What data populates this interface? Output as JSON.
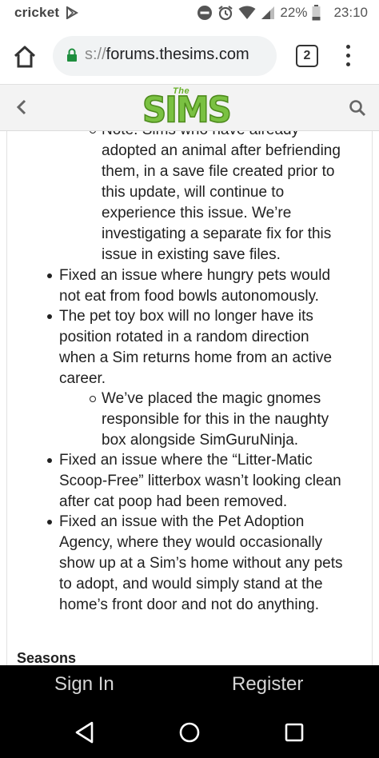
{
  "status_bar": {
    "carrier": "cricket",
    "battery": "22%",
    "time": "23:10"
  },
  "browser": {
    "url_scheme": "s://",
    "url_host": "forums.thesims.com",
    "tab_count": "2"
  },
  "site": {
    "logo_small": "The",
    "logo_main": "SIMS"
  },
  "content": {
    "note_lines": [
      "Note: Sims who have already",
      "adopted an animal after befriending",
      "them, in a save file created prior to",
      "this update, will continue to",
      "experience this issue. We’re",
      "investigating a separate fix for this",
      "issue in existing save files."
    ],
    "item1_lines": [
      "Fixed an issue where hungry pets would",
      "not eat from food bowls autonomously."
    ],
    "item2_lines": [
      "The pet toy box will no longer have its",
      "position rotated in a random direction",
      "when a Sim returns home from an active",
      "career."
    ],
    "item2_sub_lines": [
      "We’ve placed the magic gnomes",
      "responsible for this in the naughty",
      "box alongside SimGuruNinja."
    ],
    "item3_lines": [
      "Fixed an issue where the “Litter-Matic",
      "Scoop-Free” litterbox wasn’t looking clean",
      "after cat poop had been removed."
    ],
    "item4_lines": [
      "Fixed an issue with the Pet Adoption",
      "Agency, where they would occasionally",
      "show up at a Sim’s home without any pets",
      "to adopt, and would simply stand at the",
      "home’s front door and not do anything."
    ],
    "section_heading": "Seasons"
  },
  "auth": {
    "sign_in": "Sign In",
    "register": "Register"
  },
  "icons": {
    "home": "home-icon",
    "lock": "lock-icon",
    "menu": "more-vert-icon",
    "back": "chevron-left-icon",
    "search": "search-icon",
    "nav_back": "triangle-back-icon",
    "nav_home": "circle-home-icon",
    "nav_recents": "square-recents-icon"
  },
  "colors": {
    "logo_green": "#7ac142",
    "lock_green": "#1e8e3e",
    "auth_bar": "#000000"
  }
}
